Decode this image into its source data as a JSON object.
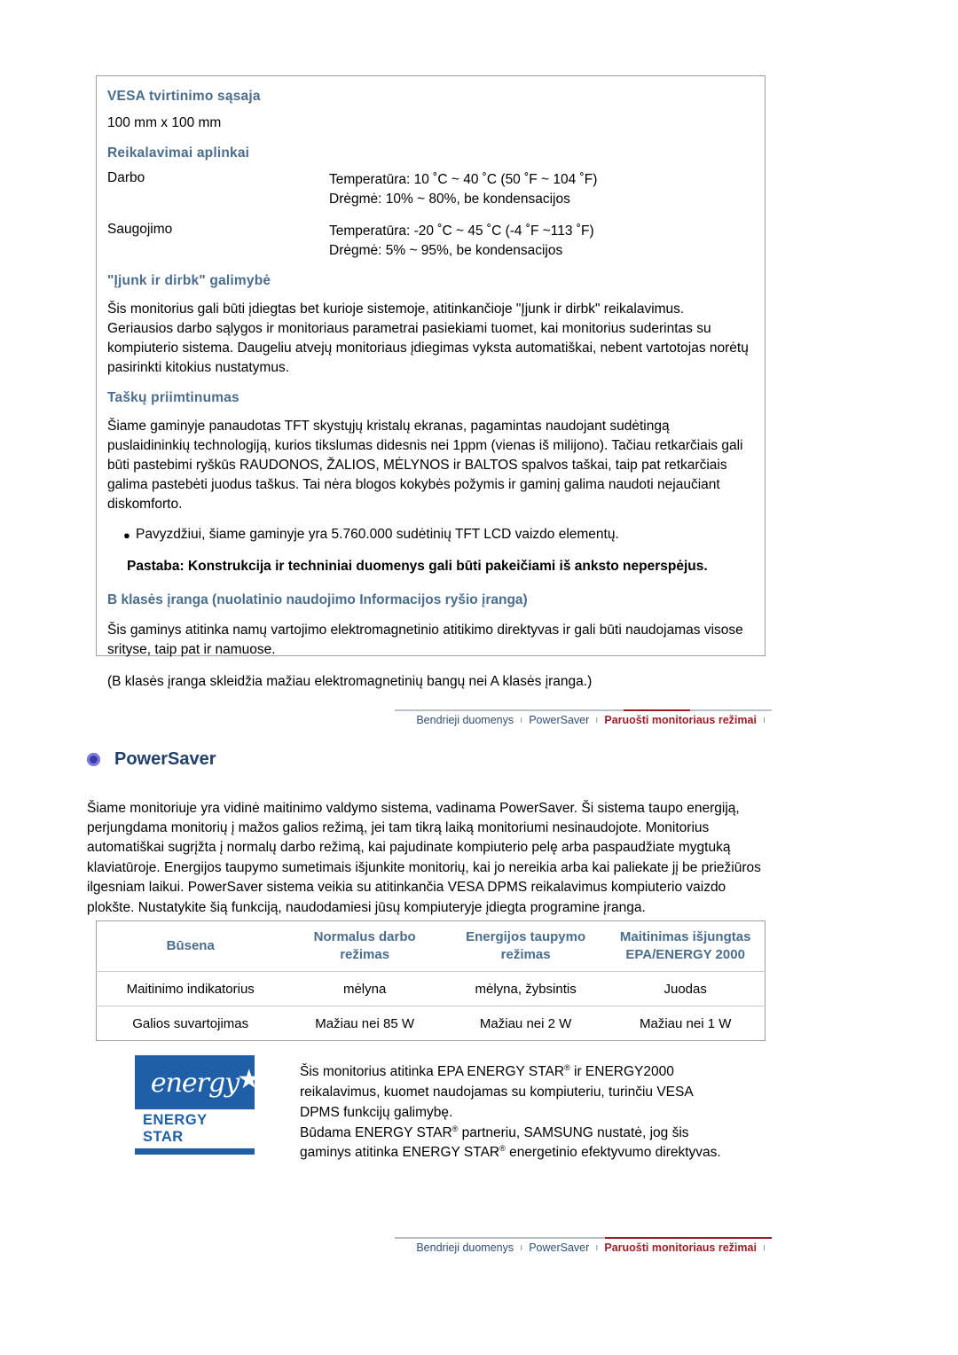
{
  "spec": {
    "vesa_title": "VESA tvirtinimo sąsaja",
    "vesa_value": "100 mm x 100 mm",
    "env_title": "Reikalavimai aplinkai",
    "env_rows": [
      {
        "key": "Darbo",
        "line1": "Temperatūra: 10 ˚C ~ 40 ˚C (50 ˚F ~ 104 ˚F)",
        "line2": "Drėgmė: 10% ~ 80%, be kondensacijos"
      },
      {
        "key": "Saugojimo",
        "line1": "Temperatūra: -20 ˚C ~ 45 ˚C (-4 ˚F ~113 ˚F)",
        "line2": "Drėgmė: 5% ~ 95%, be kondensacijos"
      }
    ],
    "pnp_title": "\"Įjunk ir dirbk\" galimybė",
    "pnp_text": "Šis monitorius gali būti įdiegtas bet kurioje sistemoje, atitinkančioje \"Įjunk ir dirbk\" reikalavimus. Geriausios darbo sąlygos ir monitoriaus parametrai pasiekiami tuomet, kai monitorius suderintas su kompiuterio sistema. Daugeliu atvejų monitoriaus įdiegimas vyksta automatiškai, nebent vartotojas norėtų pasirinkti kitokius nustatymus.",
    "dot_title": "Taškų priimtinumas",
    "dot_text": "Šiame gaminyje panaudotas TFT skystųjų kristalų ekranas, pagamintas naudojant sudėtingą puslaidininkių technologiją, kurios tikslumas didesnis nei 1ppm (vienas iš milijono). Tačiau retkarčiais gali būti pastebimi ryškūs RAUDONOS, ŽALIOS, MĖLYNOS ir BALTOS spalvos taškai, taip pat retkarčiais galima pastebėti juodus taškus. Tai nėra blogos kokybės požymis ir gaminį galima naudoti nejaučiant diskomforto.",
    "dot_bullet": "Pavyzdžiui, šiame gaminyje yra 5.760.000 sudėtinių TFT LCD vaizdo elementų.",
    "note": "Pastaba: Konstrukcija ir techniniai duomenys gali būti pakeičiami iš anksto neperspėjus.",
    "classb_title": "B klasės įranga (nuolatinio naudojimo Informacijos ryšio įranga)",
    "classb_text1": "Šis gaminys atitinka namų vartojimo elektromagnetinio atitikimo direktyvas ir gali būti naudojamas visose srityse, taip pat ir namuose.",
    "classb_text2": "(B klasės įranga skleidžia mažiau elektromagnetinių bangų nei A klasės įranga.)"
  },
  "nav_top": {
    "items": [
      {
        "label": "Bendrieji duomenys",
        "active": false
      },
      {
        "label": "PowerSaver",
        "active": false
      },
      {
        "label": "Paruošti monitoriaus režimai",
        "active": true
      }
    ],
    "separator": "ı"
  },
  "nav_bottom": {
    "items": [
      {
        "label": "Bendrieji duomenys",
        "active": false
      },
      {
        "label": "PowerSaver",
        "active": false
      },
      {
        "label": "Paruošti monitoriaus režimai",
        "active": true
      }
    ],
    "separator": "ı"
  },
  "powersaver": {
    "title": "PowerSaver",
    "paragraph": "Šiame monitoriuje yra vidinė maitinimo valdymo sistema, vadinama PowerSaver. Ši sistema taupo energiją, perjungdama monitorių į mažos galios režimą, jei tam tikrą laiką monitoriumi nesinaudojote. Monitorius automatiškai sugrįžta į normalų darbo režimą, kai pajudinate kompiuterio pelę arba paspaudžiate mygtuką klaviatūroje. Energijos taupymo sumetimais išjunkite monitorių, kai jo nereikia arba kai paliekate jį be priežiūros ilgesniam laikui. PowerSaver sistema veikia su atitinkančia VESA DPMS reikalavimus kompiuterio vaizdo plokšte. Nustatykite šią funkciją, naudodamiesi jūsų kompiuteryje įdiegta programine įranga."
  },
  "power_table": {
    "headers": [
      {
        "line1": "Būsena",
        "line2": ""
      },
      {
        "line1": "Normalus darbo",
        "line2": "režimas"
      },
      {
        "line1": "Energijos taupymo",
        "line2": "režimas"
      },
      {
        "line1": "Maitinimas išjungtas",
        "line2": "EPA/ENERGY 2000"
      }
    ],
    "rows": [
      [
        "Maitinimo indikatorius",
        "mėlyna",
        "mėlyna, žybsintis",
        "Juodas"
      ],
      [
        "Galios suvartojimas",
        "Mažiau nei 85 W",
        "Mažiau nei 2 W",
        "Mažiau nei 1 W"
      ]
    ]
  },
  "energy_star": {
    "logo_script": "energy",
    "logo_badge": "ENERGY STAR",
    "text_line1": "Šis monitorius atitinka EPA ENERGY STAR",
    "text_line1b": " ir ENERGY2000",
    "text_line2": "reikalavimus, kuomet naudojamas su kompiuteriu, turinčiu VESA",
    "text_line3": "DPMS funkcijų galimybę.",
    "text_line4": "Būdama ENERGY STAR",
    "text_line4b": " partneriu, SAMSUNG nustatė, jog šis",
    "text_line5": "gaminys atitinka ENERGY STAR",
    "text_line5b": " energetinio efektyvumo direktyvas.",
    "registered_mark": "®"
  }
}
